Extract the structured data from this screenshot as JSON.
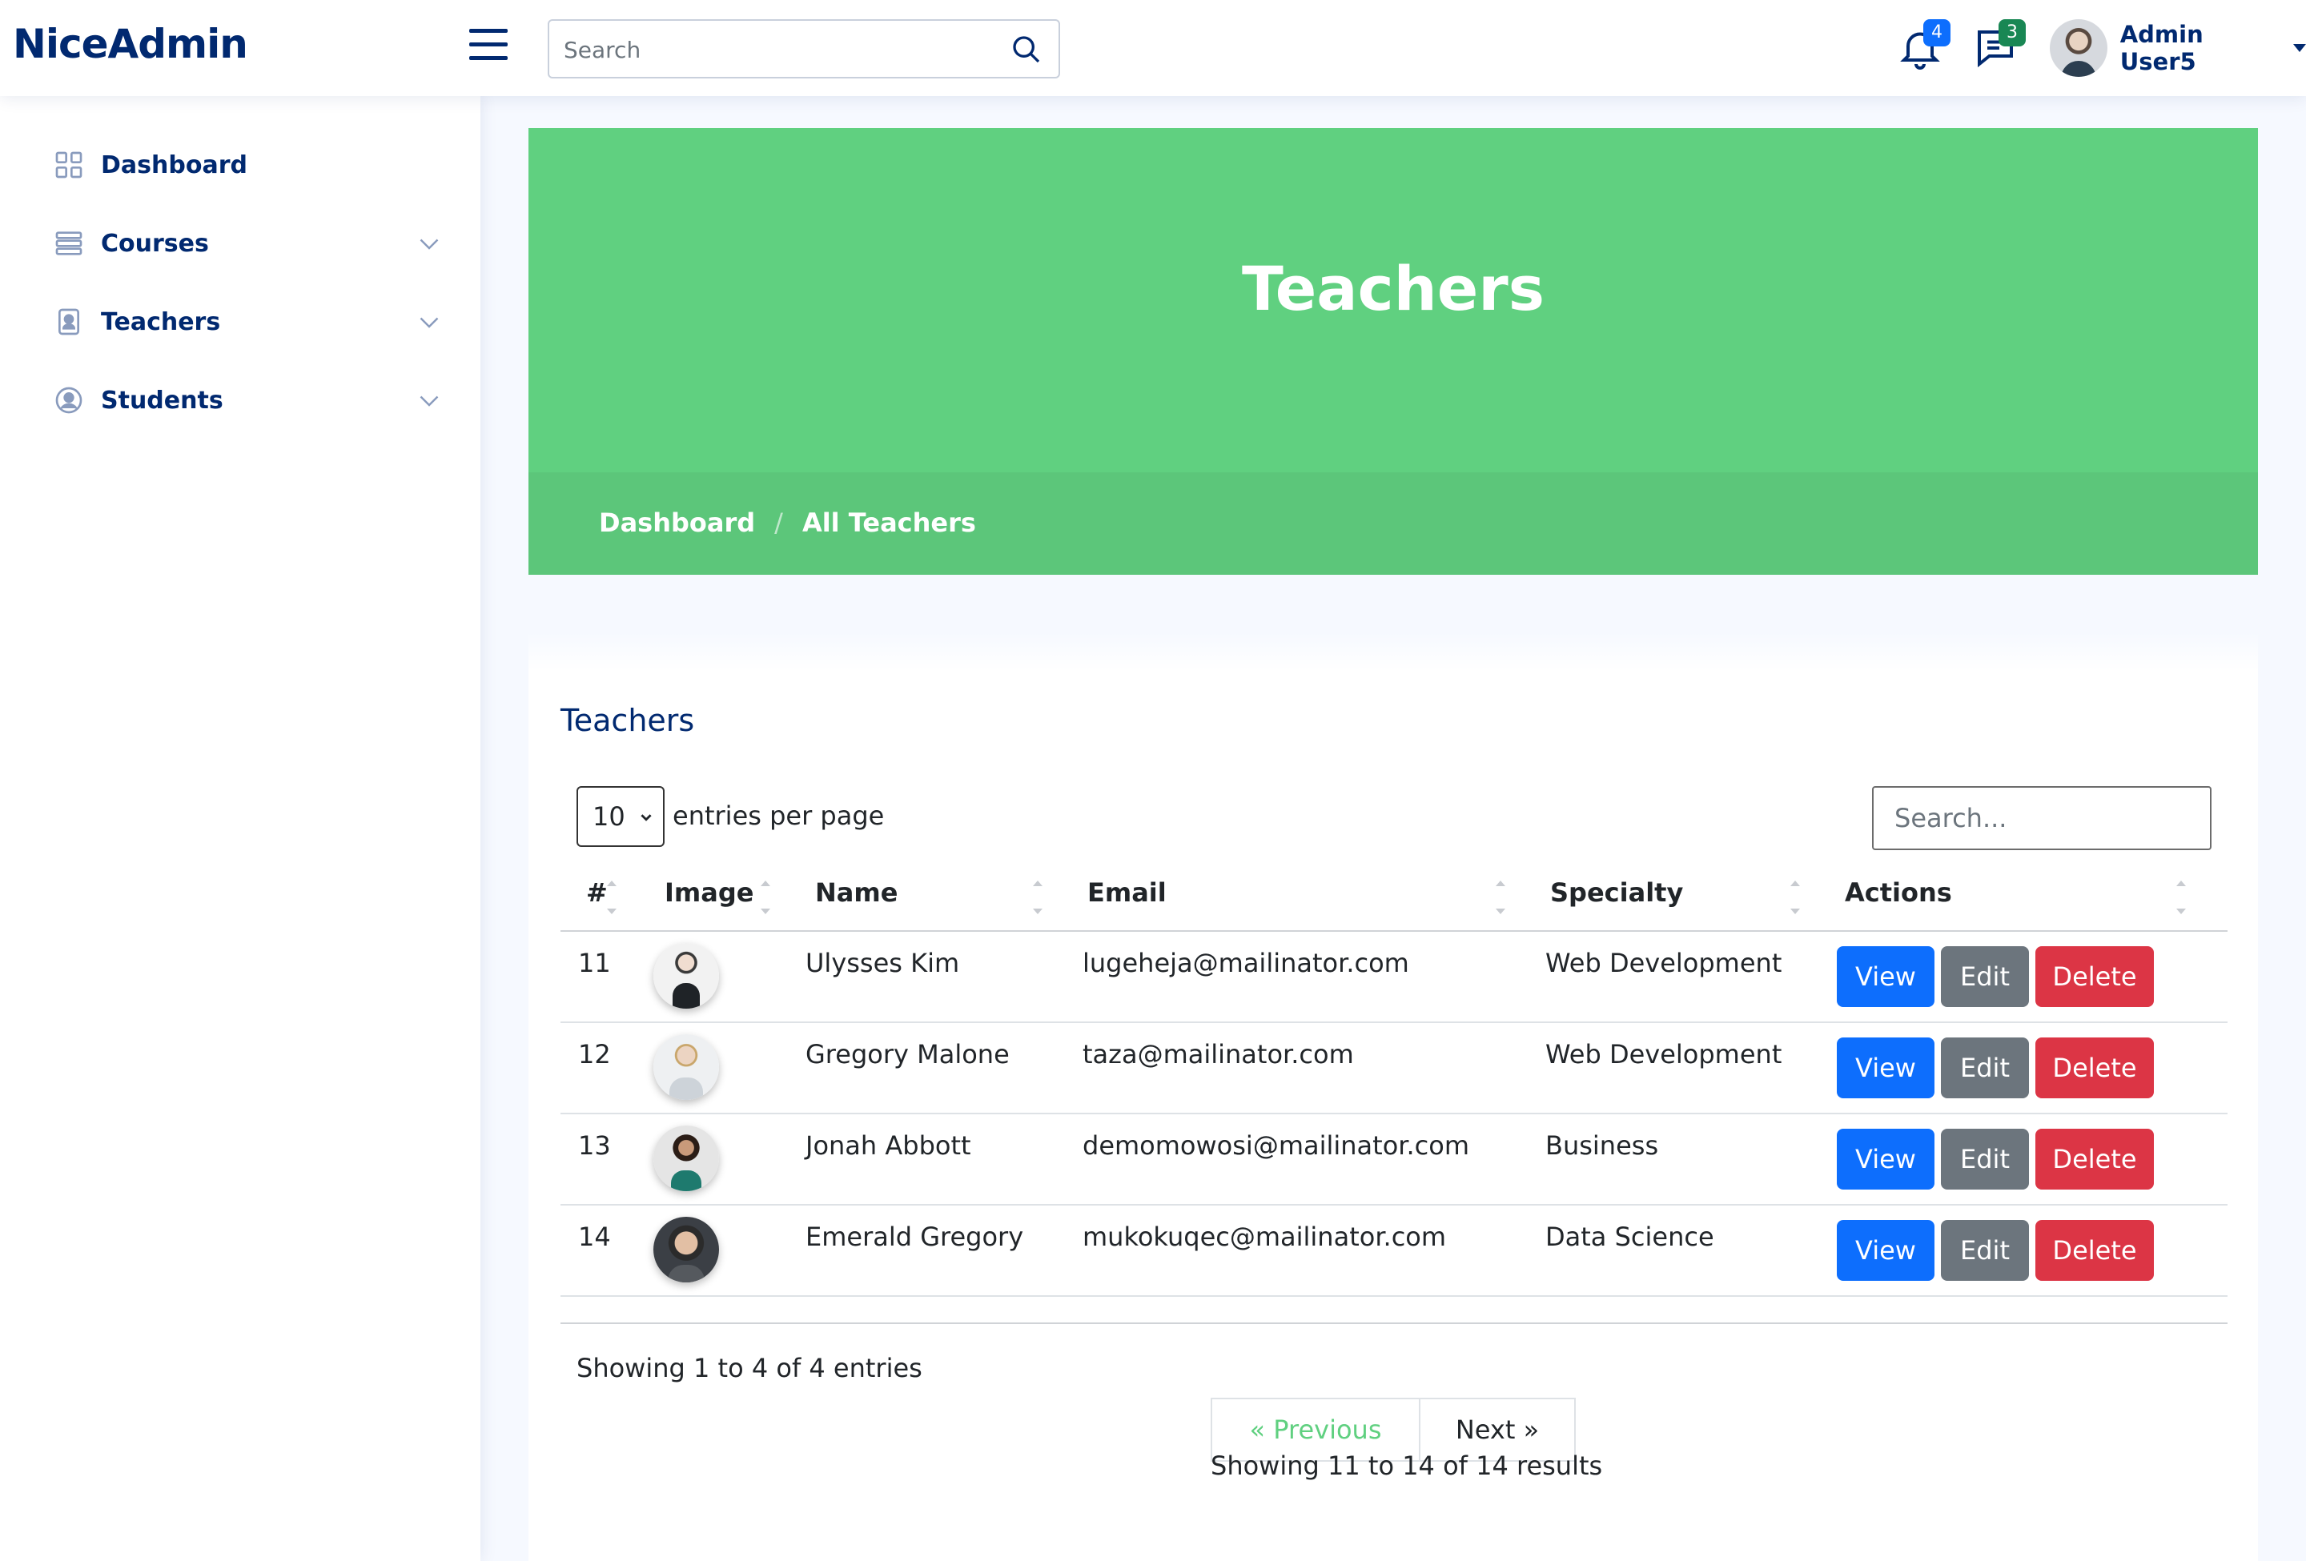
{
  "header": {
    "logo": "NiceAdmin",
    "search_placeholder": "Search",
    "notifications_count": "4",
    "messages_count": "3",
    "user_name": "Admin User5"
  },
  "sidebar": {
    "items": [
      {
        "label": "Dashboard",
        "icon": "grid-icon"
      },
      {
        "label": "Courses",
        "icon": "layers-icon"
      },
      {
        "label": "Teachers",
        "icon": "person-badge-icon"
      },
      {
        "label": "Students",
        "icon": "person-circle-icon"
      }
    ]
  },
  "hero": {
    "title": "Teachers",
    "breadcrumb": [
      "Dashboard",
      "All Teachers"
    ],
    "colors": {
      "banner": "#60d080",
      "bar": "#5cc67a"
    }
  },
  "card": {
    "title": "Teachers",
    "per_page_value": "10",
    "per_page_label": "entries per page",
    "search_placeholder": "Search...",
    "columns": [
      "#",
      "Image",
      "Name",
      "Email",
      "Specialty",
      "Actions"
    ],
    "rows": [
      {
        "id": "11",
        "name": "Ulysses Kim",
        "email": "lugeheja@mailinator.com",
        "specialty": "Web Development"
      },
      {
        "id": "12",
        "name": "Gregory Malone",
        "email": "taza@mailinator.com",
        "specialty": "Web Development"
      },
      {
        "id": "13",
        "name": "Jonah Abbott",
        "email": "demomowosi@mailinator.com",
        "specialty": "Business"
      },
      {
        "id": "14",
        "name": "Emerald Gregory",
        "email": "mukokuqec@mailinator.com",
        "specialty": "Data Science"
      }
    ],
    "actions": {
      "view": "View",
      "edit": "Edit",
      "delete": "Delete"
    },
    "showing": "Showing 1 to 4 of 4 entries",
    "pager": {
      "prev": "« Previous",
      "next": "Next »"
    },
    "results": "Showing 11 to 14 of 14 results"
  }
}
